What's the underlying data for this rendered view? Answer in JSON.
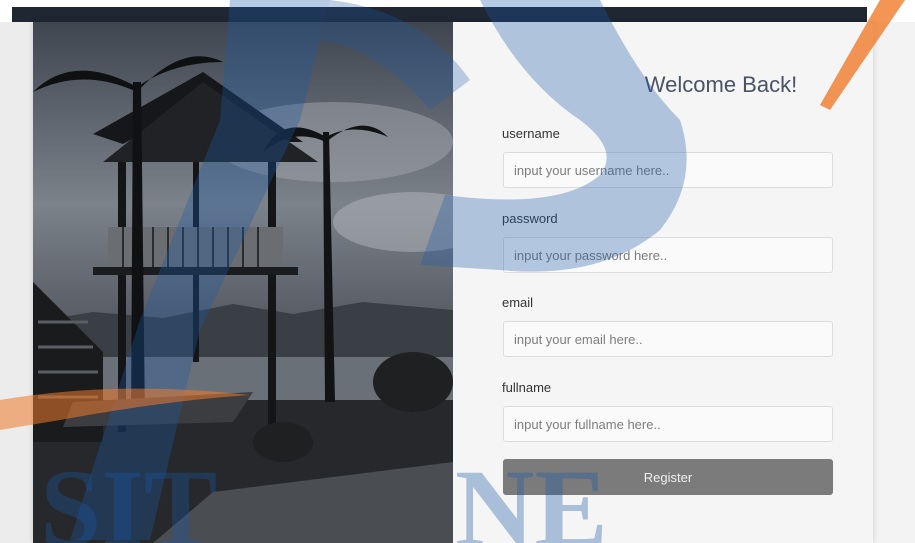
{
  "form": {
    "title": "Welcome Back!",
    "fields": [
      {
        "label": "username",
        "placeholder": "input your username here..",
        "value": ""
      },
      {
        "label": "password",
        "placeholder": "input your password here..",
        "value": ""
      },
      {
        "label": "email",
        "placeholder": "input your email here..",
        "value": ""
      },
      {
        "label": "fullname",
        "placeholder": "input your fullname here..",
        "value": ""
      }
    ],
    "submit_label": "Register"
  },
  "watermark": {
    "text_left": "SIT",
    "text_right": "NE"
  },
  "colors": {
    "watermark_blue": "#1c5aa8",
    "watermark_orange": "#f07a2a",
    "button": "#7b7b7b",
    "title": "#4a5366"
  },
  "icons": [
    "resort-photo",
    "watermark-logo"
  ]
}
